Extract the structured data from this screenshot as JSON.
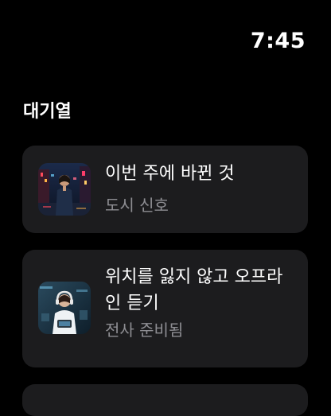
{
  "status_bar": {
    "time": "7:45"
  },
  "queue": {
    "title": "대기열",
    "items": [
      {
        "title": "이번 주에 바뀐 것",
        "subtitle": "도시 신호",
        "artwork_icon": "rainy-city-night-artwork"
      },
      {
        "title": "위치를 잃지 않고 오프라인 듣기",
        "subtitle": "전사 준비됨",
        "artwork_icon": "person-with-headphones-artwork"
      }
    ]
  },
  "colors": {
    "background": "#000000",
    "card": "#1c1c1e",
    "primary_text": "#ffffff",
    "secondary_text": "#8e8e93"
  }
}
